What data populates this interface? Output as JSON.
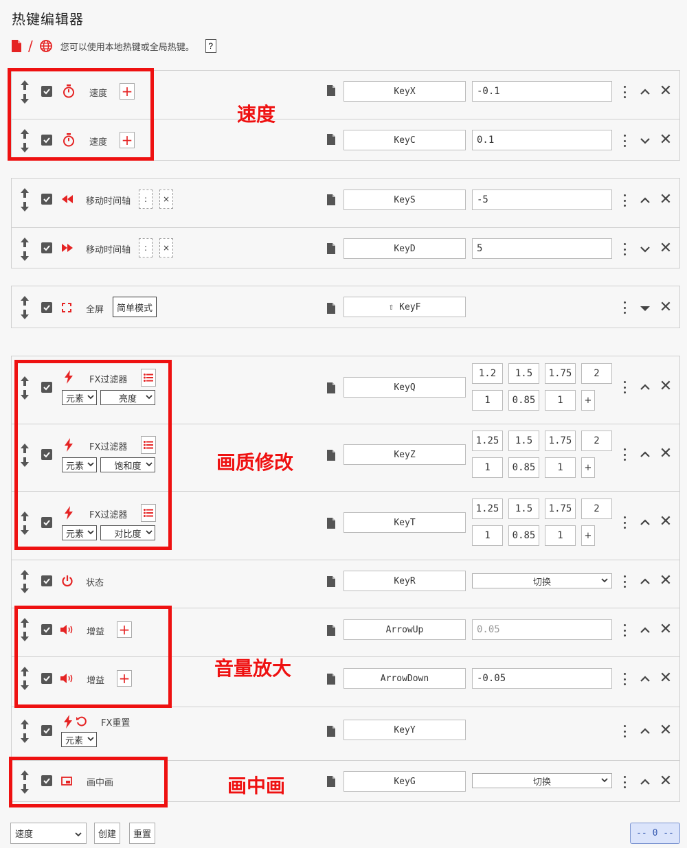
{
  "title": "热键编辑器",
  "subtitle": {
    "separator": "/",
    "text": "您可以使用本地热键或全局热键。",
    "help": "?"
  },
  "rows": [
    {
      "label": "速度",
      "key": "KeyX",
      "value": "-0.1"
    },
    {
      "label": "速度",
      "key": "KeyC",
      "value": "0.1"
    },
    {
      "label": "移动时间轴",
      "colon": ":",
      "cross": "×",
      "key": "KeyS",
      "value": "-5"
    },
    {
      "label": "移动时间轴",
      "colon": ":",
      "cross": "×",
      "key": "KeyD",
      "value": "5"
    },
    {
      "label": "全屏",
      "tag": "简单模式",
      "key": "⇧ KeyF"
    },
    {
      "label": "FX过滤器",
      "target": "元素",
      "filter": "亮度",
      "key": "KeyQ",
      "values": [
        "1.2",
        "1.5",
        "1.75",
        "2",
        "1",
        "0.85",
        "1"
      ],
      "add": "+"
    },
    {
      "label": "FX过滤器",
      "target": "元素",
      "filter": "饱和度",
      "key": "KeyZ",
      "values": [
        "1.25",
        "1.5",
        "1.75",
        "2",
        "1",
        "0.85",
        "1"
      ],
      "add": "+"
    },
    {
      "label": "FX过滤器",
      "target": "元素",
      "filter": "对比度",
      "key": "KeyT",
      "values": [
        "1.25",
        "1.5",
        "1.75",
        "2",
        "1",
        "0.85",
        "1"
      ],
      "add": "+"
    },
    {
      "label": "状态",
      "key": "KeyR",
      "select": "切换"
    },
    {
      "label": "增益",
      "key": "ArrowUp",
      "value": "0.05"
    },
    {
      "label": "增益",
      "key": "ArrowDown",
      "value": "-0.05"
    },
    {
      "label": "FX重置",
      "target": "元素",
      "key": "KeyY"
    },
    {
      "label": "画中画",
      "key": "KeyG",
      "select": "切换"
    }
  ],
  "annotations": {
    "speed": "速度",
    "quality": "画质修改",
    "volume": "音量放大",
    "pip": "画中画"
  },
  "footer": {
    "select": "速度",
    "create": "创建",
    "reset": "重置",
    "status": "-- 0 --"
  },
  "colors": {
    "accent": "#e52323",
    "annotation": "#ee1111",
    "status_bg": "#dbe4fb"
  }
}
